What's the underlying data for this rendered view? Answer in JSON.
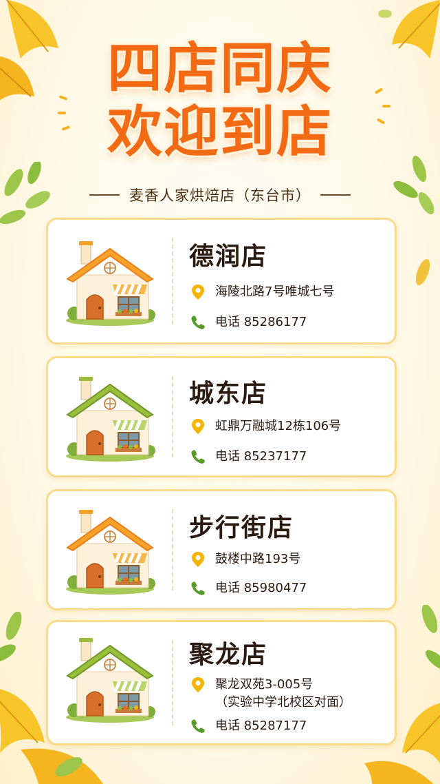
{
  "poster": {
    "title_line1": "四店同庆",
    "title_line2": "欢迎到店",
    "subtitle": "麦香人家烘焙店（东台市）",
    "colors": {
      "title": "#f26a14",
      "card_border": "#f9d98a",
      "pin": "#f5b400",
      "phone": "#5a9a2a"
    }
  },
  "stores": [
    {
      "name": "德润店",
      "address": "海陵北路7号唯城七号",
      "address2": "",
      "phone_label": "电话",
      "phone": "85286177",
      "roof": "orange"
    },
    {
      "name": "城东店",
      "address": "虹鼎万融城12栋106号",
      "address2": "",
      "phone_label": "电话",
      "phone": "85237177",
      "roof": "green"
    },
    {
      "name": "步行街店",
      "address": "鼓楼中路193号",
      "address2": "",
      "phone_label": "电话",
      "phone": "85980477",
      "roof": "orange"
    },
    {
      "name": "聚龙店",
      "address": "聚龙双苑3-005号",
      "address2": "（实验中学北校区对面）",
      "phone_label": "电话",
      "phone": "85287177",
      "roof": "green"
    }
  ],
  "icons": {
    "address": "location-pin-icon",
    "phone": "phone-icon",
    "house": "house-icon"
  }
}
